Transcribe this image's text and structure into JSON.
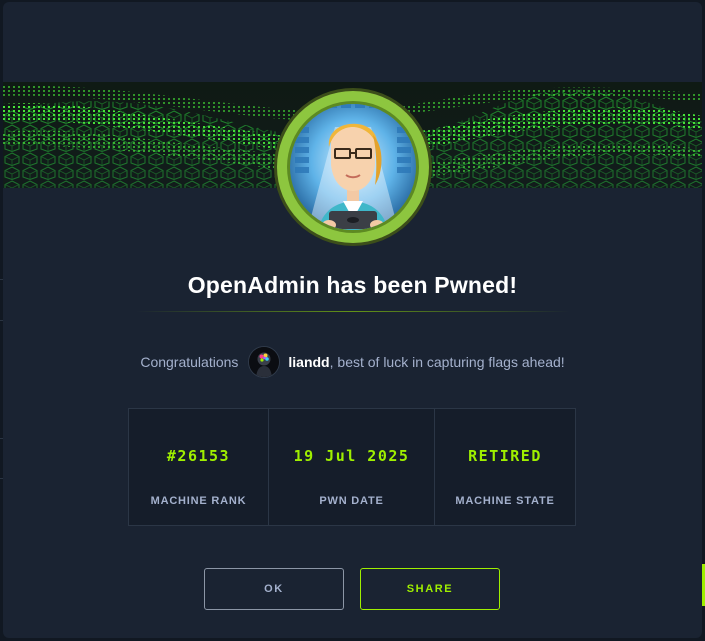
{
  "modal": {
    "title": "OpenAdmin has been Pwned!",
    "congrats_prefix": "Congratulations",
    "username": "liandd",
    "congrats_suffix": ", best of luck in capturing flags ahead!"
  },
  "stats": [
    {
      "value": "#26153",
      "label": "MACHINE RANK"
    },
    {
      "value": "19 Jul 2025",
      "label": "PWN DATE"
    },
    {
      "value": "RETIRED",
      "label": "MACHINE STATE"
    }
  ],
  "buttons": {
    "ok_label": "OK",
    "share_label": "SHARE"
  },
  "icons": {
    "machine_avatar": "admin-woman-avatar-icon",
    "user_avatar": "user-avatar-icon"
  },
  "colors": {
    "accent": "#9fef00",
    "modal_bg": "#1a2332",
    "text_muted": "#a4b1cd"
  }
}
